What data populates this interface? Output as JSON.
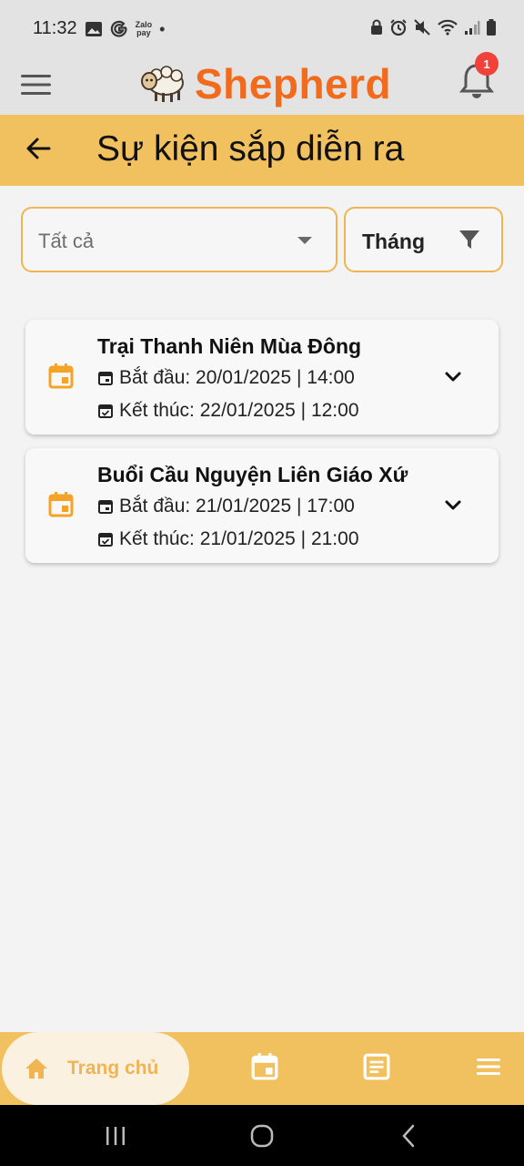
{
  "status_bar": {
    "time": "11:32",
    "zalo_line1": "Zalo",
    "zalo_line2": "pay",
    "dot": "•"
  },
  "app_bar": {
    "logo_text": "Shepherd",
    "notification_count": "1"
  },
  "title_bar": {
    "title": "Sự kiện sắp diễn ra"
  },
  "filters": {
    "category_selected": "Tất cả",
    "period_label": "Tháng"
  },
  "events": [
    {
      "title": "Trại Thanh Niên Mùa Đông",
      "start": "Bắt đầu: 20/01/2025 | 14:00",
      "end": "Kết thúc: 22/01/2025 | 12:00"
    },
    {
      "title": "Buổi Cầu Nguyện Liên Giáo Xứ",
      "start": "Bắt đầu: 21/01/2025 | 17:00",
      "end": "Kết thúc: 21/01/2025 | 21:00"
    }
  ],
  "bottom_nav": {
    "home_label": "Trang chủ"
  },
  "colors": {
    "accent": "#f1c15f",
    "logo": "#f26b1d",
    "icon_orange": "#f4a326",
    "badge": "#f0413a"
  },
  "icons": [
    "menu-icon",
    "sheep-logo",
    "bell-icon",
    "arrow-back-icon",
    "dropdown-caret-icon",
    "filter-funnel-icon",
    "calendar-icon",
    "event-start-icon",
    "event-end-icon",
    "chevron-down-icon",
    "home-icon",
    "article-icon",
    "hamburger-icon"
  ]
}
